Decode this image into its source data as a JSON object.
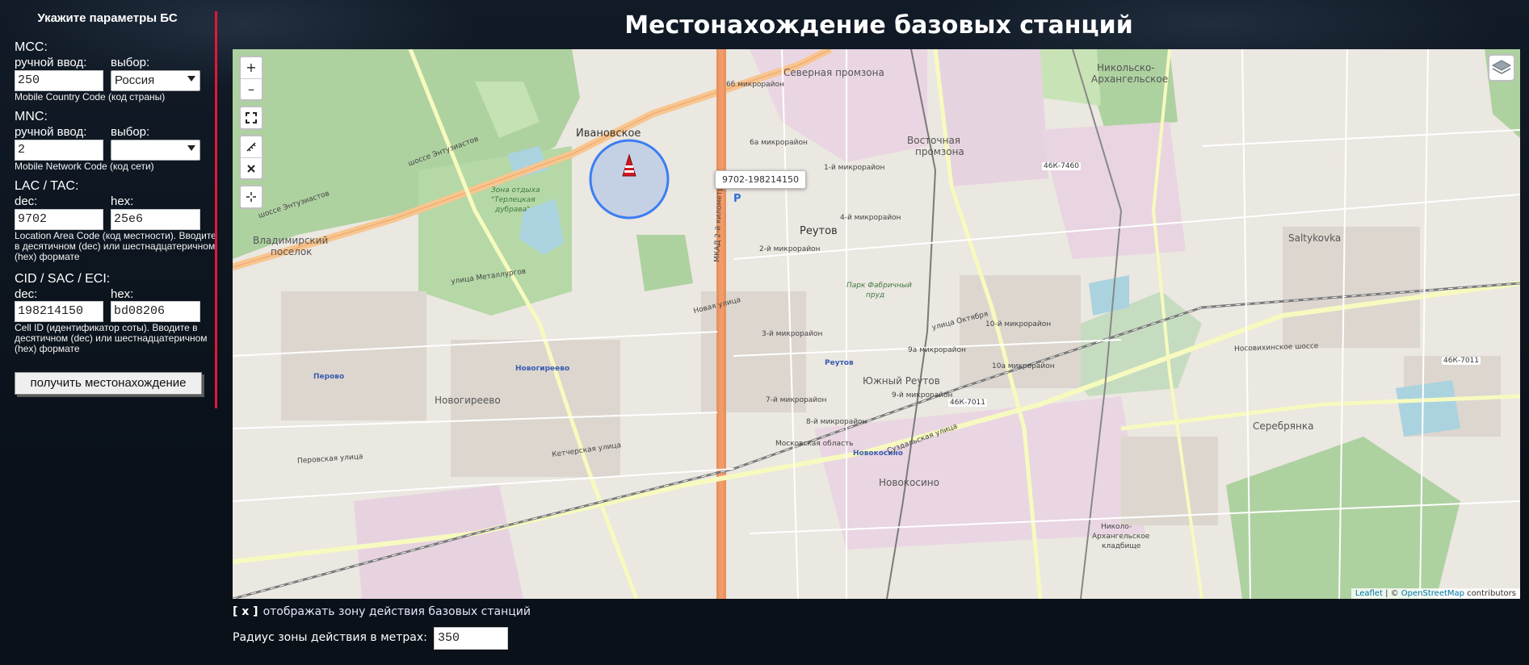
{
  "page": {
    "title": "Местонахождение базовых станций"
  },
  "sidebar": {
    "title": "Укажите параметры БС",
    "mcc": {
      "label": "MCC:",
      "manual_label": "ручной ввод:",
      "select_label": "выбор:",
      "manual_value": "250",
      "select_value": "Россия",
      "hint": "Mobile Country Code (код страны)"
    },
    "mnc": {
      "label": "MNC:",
      "manual_label": "ручной ввод:",
      "select_label": "выбор:",
      "manual_value": "2",
      "select_value": "",
      "hint": "Mobile Network Code (код сети)"
    },
    "lac": {
      "label": "LAC / TAC:",
      "dec_label": "dec:",
      "hex_label": "hex:",
      "dec_value": "9702",
      "hex_value": "25e6",
      "hint": "Location Area Code (код местности). Вводите в десятичном (dec) или шестнадцатеричном (hex) формате"
    },
    "cid": {
      "label": "CID / SAC / ECI:",
      "dec_label": "dec:",
      "hex_label": "hex:",
      "dec_value": "198214150",
      "hex_value": "bd08206",
      "hint": "Cell ID (идентификатор соты). Вводите в десятичном (dec) или шестнадцатеричном (hex) формате"
    },
    "submit_label": "получить местонахождение"
  },
  "map": {
    "zoom_in": "+",
    "zoom_out": "–",
    "popup": "9702-198214150",
    "attribution": {
      "leaflet": "Leaflet",
      "sep": " | © ",
      "osm": "OpenStreetMap",
      "suffix": " contributors"
    },
    "labels": {
      "ivanovskoe": "Ивановское",
      "reutov": "Реутов",
      "vladimirsky": "Владимирский",
      "poselok": "поселок",
      "novogireevo": "Новогиреево",
      "novogireevo_station": "Новогиреево",
      "perovo_station": "Перово",
      "reutov_station": "Реутов",
      "yuzhny_reutov": "Южный Реутов",
      "severnaya_promzona": "Северная промзона",
      "vostochnaya": "Восточная",
      "promzona": "промзона",
      "nikolsko": "Никольско-",
      "arkhangelskoe": "Архангельское",
      "saltykovka": "Saltykovka",
      "serebryanka": "Серебрянка",
      "novokosino": "Новокосино",
      "novokosino_station": "Новокосино",
      "zona_otdykha": "Зона отдыха",
      "terletskaya": "\"Терлецкая",
      "dubrava": "дубрава\"",
      "nikolo": "Николо-",
      "arkh_kladbishe": "Архангельское",
      "kladbishe": "кладбище",
      "shosse_entuziastov": "шоссе Энтузиастов",
      "mkad": "МКАД 2-й километр",
      "metallurgov": "улица Металлургов",
      "nosovikhinskoe": "Носовихинское шоссе",
      "perovskaya": "Перовская улица",
      "ketcherskaya": "Кетчерская улица",
      "road_46k7460": "46К-7460",
      "road_46k7011": "46К-7011",
      "road_46k7011b": "46К-7011",
      "mikro_1": "1-й микрорайон",
      "mikro_2": "2-й микрорайон",
      "mikro_3": "3-й микрорайон",
      "mikro_4": "4-й микрорайон",
      "mikro_7": "7-й микрорайон",
      "mikro_8": "8-й микрорайон",
      "mikro_9": "9-й микрорайон",
      "mikro_10": "10-й микрорайон",
      "mikro_9a": "9а микрорайон",
      "mikro_10a": "10а микрорайон",
      "mikro_6a": "6а микрорайон",
      "mikro_6b": "6б микрорайон",
      "moskovskaya_oblast": "Московская область",
      "ulitsa_oktyabrya": "улица Октября",
      "novaya_ulitsa": "Новая улица",
      "sudalskaya": "Суздальская улица",
      "park_fabrichny": "Парк Фабричный",
      "prud": "пруд",
      "parking": "P"
    }
  },
  "zone_toggle": {
    "mark": "[ x ]",
    "label": "отображать зону действия базовых станций"
  },
  "radius": {
    "label": "Радиус зоны действия в метрах:",
    "value": "350"
  },
  "colors": {
    "accent_divider": "#e3173a",
    "coverage_circle": "#3b7ef3",
    "marker": "#d4181f",
    "background": "#0a1119"
  }
}
